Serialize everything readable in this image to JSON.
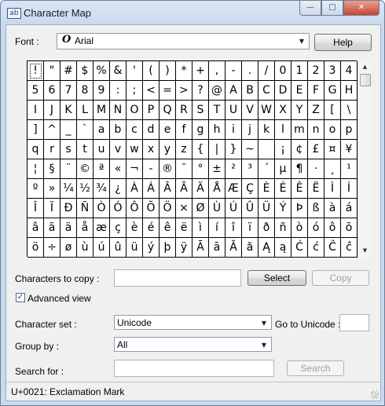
{
  "window": {
    "title": "Character Map",
    "icon": "character-map-app-icon",
    "controls": [
      "minimize",
      "maximize",
      "close"
    ]
  },
  "font": {
    "label": "Font :",
    "value": "Arial",
    "glyph": "O",
    "help_label": "Help"
  },
  "grid": {
    "selected_index": 0,
    "rows": [
      [
        "!",
        "\"",
        "#",
        "$",
        "%",
        "&",
        "'",
        "(",
        ")",
        "*",
        "+",
        ",",
        "-",
        ".",
        "/",
        "0",
        "1",
        "2",
        "3",
        "4"
      ],
      [
        "5",
        "6",
        "7",
        "8",
        "9",
        ":",
        ";",
        "<",
        "=",
        ">",
        "?",
        "@",
        "A",
        "B",
        "C",
        "D",
        "E",
        "F",
        "G",
        "H"
      ],
      [
        "I",
        "J",
        "K",
        "L",
        "M",
        "N",
        "O",
        "P",
        "Q",
        "R",
        "S",
        "T",
        "U",
        "V",
        "W",
        "X",
        "Y",
        "Z",
        "[",
        "\\"
      ],
      [
        "]",
        "^",
        "_",
        "`",
        "a",
        "b",
        "c",
        "d",
        "e",
        "f",
        "g",
        "h",
        "i",
        "j",
        "k",
        "l",
        "m",
        "n",
        "o",
        "p"
      ],
      [
        "q",
        "r",
        "s",
        "t",
        "u",
        "v",
        "w",
        "x",
        "y",
        "z",
        "{",
        "|",
        "}",
        "~",
        " ",
        "¡",
        "¢",
        "£",
        "¤",
        "¥"
      ],
      [
        "¦",
        "§",
        "¨",
        "©",
        "ª",
        "«",
        "¬",
        "-",
        "®",
        "¯",
        "°",
        "±",
        "²",
        "³",
        "´",
        "µ",
        "¶",
        "·",
        "¸",
        "¹"
      ],
      [
        "º",
        "»",
        "¼",
        "½",
        "¾",
        "¿",
        "À",
        "Á",
        "Â",
        "Ã",
        "Ä",
        "Å",
        "Æ",
        "Ç",
        "È",
        "É",
        "Ê",
        "Ë",
        "Ì",
        "Í"
      ],
      [
        "Î",
        "Ï",
        "Ð",
        "Ñ",
        "Ò",
        "Ó",
        "Ô",
        "Õ",
        "Ö",
        "×",
        "Ø",
        "Ù",
        "Ú",
        "Û",
        "Ü",
        "Ý",
        "Þ",
        "ß",
        "à",
        "á"
      ],
      [
        "â",
        "ã",
        "ä",
        "å",
        "æ",
        "ç",
        "è",
        "é",
        "ê",
        "ë",
        "ì",
        "í",
        "î",
        "ï",
        "ð",
        "ñ",
        "ò",
        "ó",
        "ô",
        "õ"
      ],
      [
        "ö",
        "÷",
        "ø",
        "ù",
        "ú",
        "û",
        "ü",
        "ý",
        "þ",
        "ÿ",
        "Ā",
        "ā",
        "Ă",
        "ă",
        "Ą",
        "ą",
        "Ć",
        "ć",
        "Ĉ",
        "ĉ"
      ]
    ]
  },
  "copy": {
    "label": "Characters to copy :",
    "value": "",
    "select_label": "Select",
    "copy_label": "Copy"
  },
  "advanced": {
    "label": "Advanced view",
    "checked": true,
    "check_glyph": "✓"
  },
  "charset": {
    "label": "Character set :",
    "value": "Unicode",
    "goto_label": "Go to Unicode :",
    "goto_value": ""
  },
  "group": {
    "label": "Group by :",
    "value": "All"
  },
  "search": {
    "label": "Search for :",
    "value": "",
    "button_label": "Search"
  },
  "status": {
    "text": "U+0021: Exclamation Mark"
  },
  "glyphs": {
    "dropdown": "▼",
    "scroll_up": "▲",
    "scroll_down": "▼",
    "app": "ab",
    "minimize": "—",
    "maximize": "□",
    "close": "✕"
  }
}
